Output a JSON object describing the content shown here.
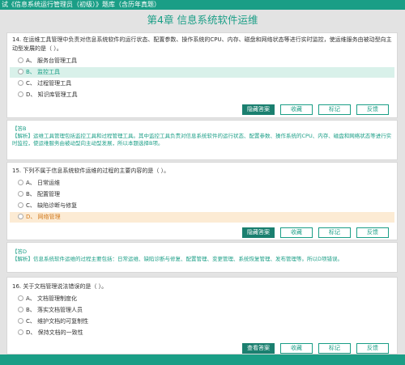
{
  "header": {
    "title": "试《信息系统运行管理员（初级）》题库（含历年真题）"
  },
  "chapter": {
    "title": "第4章   信息系统软件运维"
  },
  "buttons": {
    "hide": "隐藏答案",
    "view": "查看答案",
    "favorite": "收藏",
    "mark": "标记",
    "feedback": "反馈"
  },
  "questions": [
    {
      "text": "14. 在运维工具管理中负责对信息系统软件的运行状态、配置参数、操作系统的CPU、内存、磁盘和网络状态等进行实时监控，使运维服务由被动型向主动型发展的是（    ）。",
      "options": [
        "A、 服务台管理工具",
        "B、 监控工具",
        "C、 过程管理工具",
        "D、 知识库管理工具"
      ],
      "answer_label": "【答B",
      "analysis": "【解析】运维工具管理包括监控工具和过程管理工具。其中监控工具负责对信息系统软件的运行状态、配置参数、操作系统的CPU、内存、磁盘和网络状态等进行实时监控，使运维服务由被动型向主动型发展，所以本题选择B项。"
    },
    {
      "text": "15. 下列不属于信息系统软件运维的过程的主要内容的是（    ）。",
      "options": [
        "A、 日常运维",
        "B、 配置管理",
        "C、 缺陷诊断与修复",
        "D、 网络管理"
      ],
      "answer_label": "【答D",
      "analysis": "【解析】信息系统软件运维的过程主要包括：日常运维、缺陷诊断与修复、配置管理、变更管理、系统恢复管理、发布管理等。所以D项错误。"
    },
    {
      "text": "16. 关于文档管理说法错误的是（    ）。",
      "options": [
        "A、 文档管理制度化",
        "B、 落实文档管理人员",
        "C、 维护文档的可复制性",
        "D、 保持文档的一致性"
      ]
    }
  ]
}
